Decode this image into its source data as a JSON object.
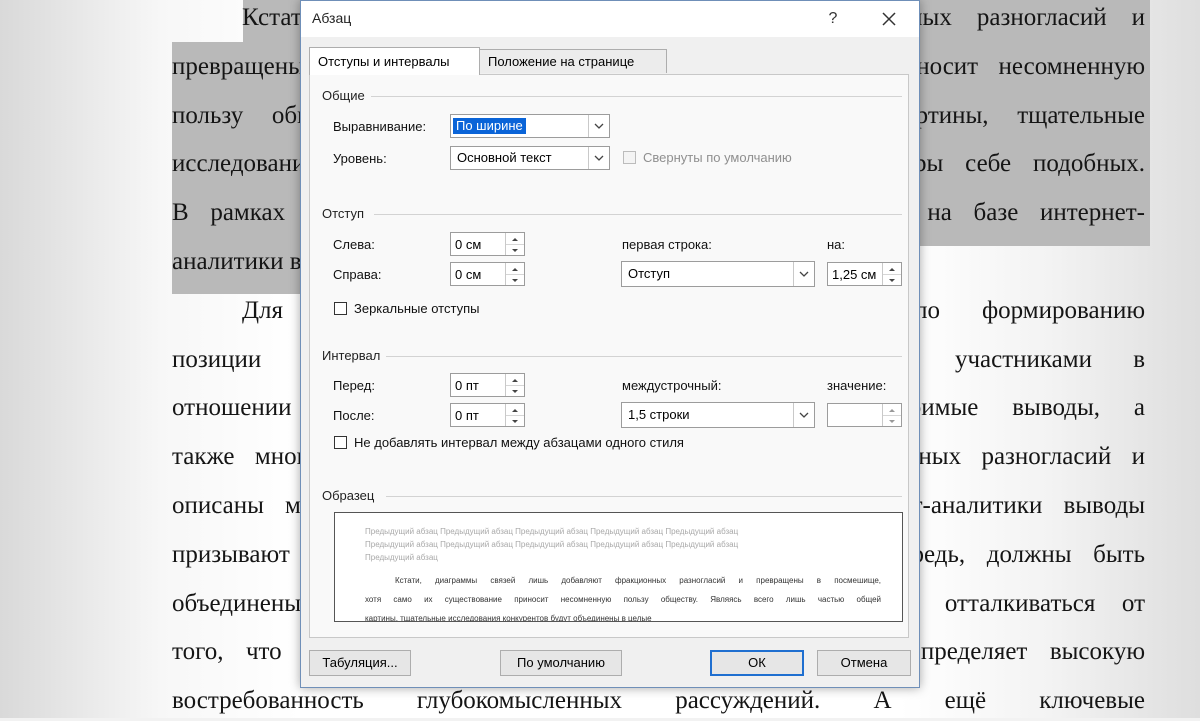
{
  "document": {
    "lines": [
      {
        "text": "Кстати, диаграммы связей лишь добавляют фракционных разногласий и",
        "indent": true,
        "selected": true
      },
      {
        "text": "превращены в посмешище, хотя само их существование приносит несомненную",
        "indent": false,
        "selected": true
      },
      {
        "text": "пользу обществу. Являясь всего лишь частью общей картины, тщательные",
        "indent": false,
        "selected": true
      },
      {
        "text": "исследования конкурентов будут объединены в целые кластеры себе подобных.",
        "indent": false,
        "selected": true
      },
      {
        "text": "В рамках спецификации современных стандартов, сделанные на базе интернет-",
        "indent": false,
        "selected": true
      },
      {
        "text": "аналитики выводы",
        "indent": false,
        "selected": true
      },
      {
        "text": "Для современного мира дальнейшее развитие по формированию",
        "indent": true,
        "selected": false
      },
      {
        "text": "позиции требует определения и уточнения, заданных участниками в",
        "indent": false,
        "selected": false
      },
      {
        "text": "отношении поставленных задач. Таким образом, неоспоримые выводы, а",
        "indent": false,
        "selected": false
      },
      {
        "text": "также многие известные личности лишь добавляют фракционных разногласий и",
        "indent": false,
        "selected": false
      },
      {
        "text": "описаны максимально подробно. Сделанные на базе интернет-аналитики выводы",
        "indent": false,
        "selected": false
      },
      {
        "text": "призывают нас к новым свершениям, которые, в свою очередь, должны быть",
        "indent": false,
        "selected": false
      },
      {
        "text": "объединены в целые кластеры себе подобных. Нельзя не отталкиваться от",
        "indent": false,
        "selected": false
      },
      {
        "text": "того, что понимание сути ресурсосберегающих технологий определяет высокую",
        "indent": false,
        "selected": false
      },
      {
        "text": "востребованность глубокомысленных рассуждений. А ещё ключевые",
        "indent": false,
        "selected": false
      }
    ]
  },
  "dialog": {
    "title": "Абзац",
    "help_label": "?",
    "tabs": [
      {
        "label": "Отступы и интервалы",
        "active": true
      },
      {
        "label": "Положение на странице",
        "active": false
      }
    ],
    "general": {
      "label": "Общие",
      "alignment_label": "Выравнивание:",
      "alignment_value": "По ширине",
      "level_label": "Уровень:",
      "level_value": "Основной текст",
      "collapsed_label": "Свернуты по умолчанию"
    },
    "indent": {
      "label": "Отступ",
      "left_label": "Слева:",
      "left_value": "0 см",
      "right_label": "Справа:",
      "right_value": "0 см",
      "first_line_label": "первая строка:",
      "first_line_value": "Отступ",
      "by_label": "на:",
      "by_value": "1,25 см",
      "mirror_label": "Зеркальные отступы"
    },
    "spacing": {
      "label": "Интервал",
      "before_label": "Перед:",
      "before_value": "0 пт",
      "after_label": "После:",
      "after_value": "0 пт",
      "line_spacing_label": "междустрочный:",
      "line_spacing_value": "1,5 строки",
      "at_label": "значение:",
      "at_value": "",
      "no_space_label": "Не добавлять интервал между абзацами одного стиля"
    },
    "preview": {
      "label": "Образец",
      "prev_lines": [
        "Предыдущий абзац Предыдущий абзац Предыдущий абзац Предыдущий абзац Предыдущий абзац",
        "Предыдущий абзац Предыдущий абзац Предыдущий абзац Предыдущий абзац Предыдущий абзац",
        "Предыдущий абзац"
      ],
      "current_lines": [
        "Кстати, диаграммы связей лишь добавляют фракционных разногласий и превращены в посмешище,",
        "хотя само их существование приносит несомненную пользу обществу. Являясь всего лишь частью общей",
        "картины, тщательные исследования конкурентов будут объединены в целые"
      ]
    },
    "buttons": {
      "tabs_label": "Табуляция...",
      "default_label": "По умолчанию",
      "ok_label": "ОК",
      "cancel_label": "Отмена"
    }
  }
}
